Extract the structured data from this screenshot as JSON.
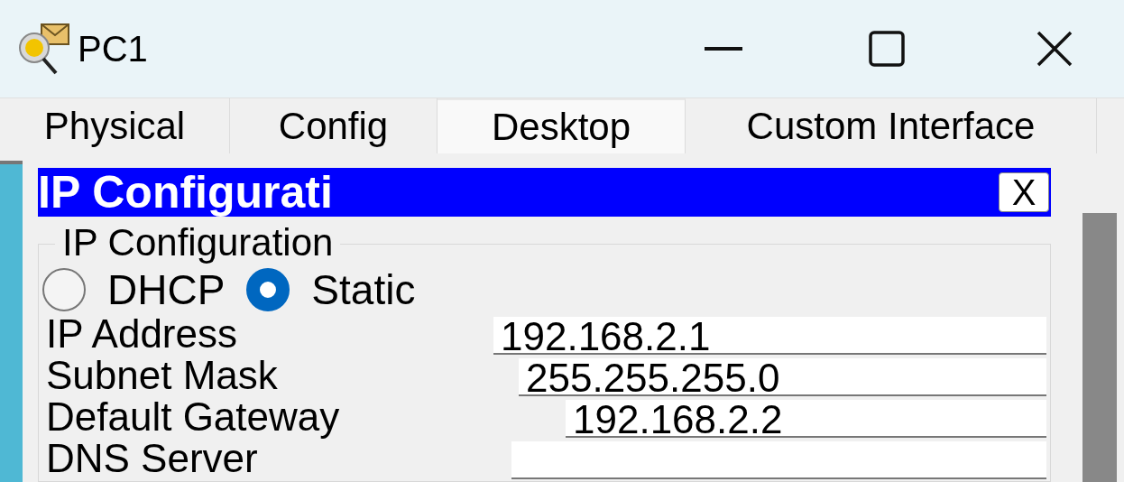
{
  "window": {
    "title": "PC1"
  },
  "tabs": [
    {
      "label": "Physical",
      "selected": false
    },
    {
      "label": "Config",
      "selected": false
    },
    {
      "label": "Desktop",
      "selected": true
    },
    {
      "label": "Custom Interface",
      "selected": false
    }
  ],
  "dialog": {
    "title": "IP Configurati",
    "close": "X",
    "group": {
      "legend": "IP Configuration",
      "modes": [
        {
          "label": "DHCP",
          "selected": false
        },
        {
          "label": "Static",
          "selected": true
        }
      ],
      "fields": [
        {
          "label": "IP Address",
          "value": "192.168.2.1"
        },
        {
          "label": "Subnet Mask",
          "value": "255.255.255.0"
        },
        {
          "label": "Default Gateway",
          "value": "192.168.2.2"
        },
        {
          "label": "DNS Server"
        }
      ]
    }
  }
}
